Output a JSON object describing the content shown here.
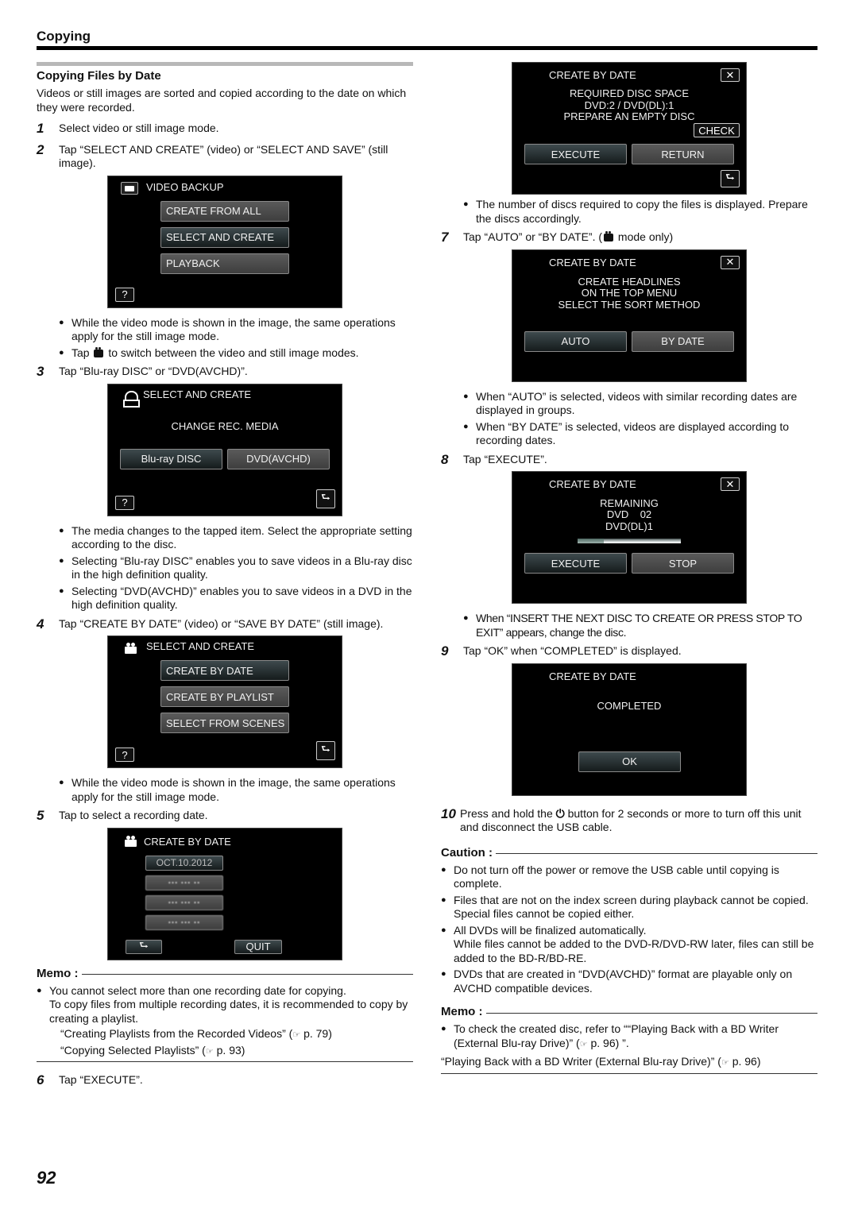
{
  "header": {
    "title": "Copying"
  },
  "section": {
    "title": "Copying Files by Date",
    "intro": "Videos or still images are sorted and copied according to the date on which they were recorded."
  },
  "steps": {
    "s1": {
      "num": "1",
      "text": "Select video or still image mode."
    },
    "s2": {
      "num": "2",
      "text": "Tap “SELECT AND CREATE” (video) or “SELECT AND SAVE” (still image)."
    },
    "s2_bullets": [
      "While the video mode is shown in the image, the same operations apply for the still image mode.",
      "to switch between the video and still image modes."
    ],
    "s2_bullet2_prefix": "Tap",
    "s3": {
      "num": "3",
      "text": "Tap “Blu-ray DISC” or “DVD(AVCHD)”."
    },
    "s3_bullets": [
      "The media changes to the tapped item. Select the appropriate setting according to the disc.",
      "Selecting “Blu-ray DISC” enables you to save videos in a Blu-ray disc in the high definition quality.",
      "Selecting “DVD(AVCHD)” enables you to save videos in a DVD in the high definition quality."
    ],
    "s4": {
      "num": "4",
      "text": "Tap “CREATE BY DATE” (video) or “SAVE BY DATE” (still image)."
    },
    "s4_bullets": [
      "While the video mode is shown in the image, the same operations apply for the still image mode."
    ],
    "s5": {
      "num": "5",
      "text": "Tap to select a recording date."
    },
    "s6": {
      "num": "6",
      "text": "Tap “EXECUTE”."
    },
    "s6_bullets": [
      "The number of discs required to copy the files is displayed. Prepare the discs accordingly."
    ],
    "s7": {
      "num": "7",
      "text_a": "Tap “AUTO” or “BY DATE”. (",
      "text_b": "mode only)"
    },
    "s7_bullets": [
      "When “AUTO” is selected, videos with similar recording dates are displayed in groups.",
      "When “BY DATE” is selected, videos are displayed according to recording dates."
    ],
    "s8": {
      "num": "8",
      "text": "Tap “EXECUTE”."
    },
    "s8_bullets": [
      "When “INSERT THE NEXT DISC TO CREATE OR PRESS STOP TO EXIT” appears, change the disc."
    ],
    "s9": {
      "num": "9",
      "text": "Tap “OK” when “COMPLETED” is displayed."
    },
    "s10": {
      "num": "10",
      "text_a": "Press and hold the",
      "text_b": "button for 2 seconds or more to turn off this unit and disconnect the USB cable."
    }
  },
  "screens": {
    "video_backup": {
      "title": "VIDEO BACKUP",
      "buttons": [
        "CREATE FROM ALL",
        "SELECT AND CREATE",
        "PLAYBACK"
      ],
      "help": "?"
    },
    "change_media": {
      "title": "SELECT AND CREATE",
      "message": "CHANGE REC. MEDIA",
      "buttons": [
        "Blu-ray DISC",
        "DVD(AVCHD)"
      ],
      "help": "?"
    },
    "select_create": {
      "title": "SELECT AND CREATE",
      "buttons": [
        "CREATE BY DATE",
        "CREATE BY PLAYLIST",
        "SELECT FROM SCENES"
      ],
      "help": "?"
    },
    "create_by_date_list": {
      "title": "CREATE BY DATE",
      "dates": [
        "OCT.10.2012",
        "▪▪▪ ▪▪▪ ▪▪",
        "▪▪▪ ▪▪▪ ▪▪",
        "▪▪▪ ▪▪▪ ▪▪"
      ],
      "quit": "QUIT"
    },
    "required_space": {
      "title": "CREATE BY DATE",
      "lines": [
        "REQUIRED DISC SPACE",
        "DVD:2 / DVD(DL):1",
        "PREPARE AN EMPTY DISC"
      ],
      "check": "CHECK",
      "buttons": [
        "EXECUTE",
        "RETURN"
      ]
    },
    "sort_method": {
      "title": "CREATE BY DATE",
      "lines": [
        "CREATE HEADLINES",
        "ON THE TOP MENU",
        "SELECT THE SORT METHOD"
      ],
      "buttons": [
        "AUTO",
        "BY DATE"
      ]
    },
    "remaining": {
      "title": "CREATE BY DATE",
      "lines": [
        "REMAINING",
        "DVD    02",
        "DVD(DL)1"
      ],
      "progress_percent": 25,
      "buttons": [
        "EXECUTE",
        "STOP"
      ]
    },
    "completed": {
      "title": "CREATE BY DATE",
      "message": "COMPLETED",
      "ok": "OK"
    }
  },
  "memo_left": {
    "heading": "Memo :",
    "bullet_lines": [
      "You cannot select more than one recording date for copying.",
      "To copy files from multiple recording dates, it is recommended to copy by creating a playlist."
    ],
    "refs": [
      {
        "text": "“Creating Playlists from the Recorded Videos” (",
        "page": "p. 79)"
      },
      {
        "text": "“Copying Selected Playlists” (",
        "page": "p. 93)"
      }
    ]
  },
  "caution": {
    "heading": "Caution :",
    "bullets": [
      "Do not turn off the power or remove the USB cable until copying is complete.",
      "Files that are not on the index screen during playback cannot be copied. Special files cannot be copied either.",
      "All DVDs will be finalized automatically.",
      "DVDs that are created in “DVD(AVCHD)” format are playable only on AVCHD compatible devices."
    ],
    "bullet3_extra": "While files cannot be added to the DVD-R/DVD-RW later, files can still be added to the BD-R/BD-RE."
  },
  "memo_right": {
    "heading": "Memo :",
    "bullet": "To check the created disc, refer to ““Playing Back with a BD Writer (External Blu-ray Drive)” (",
    "bullet_page": "p. 96) ”.",
    "ref": {
      "text": "“Playing Back with a BD Writer (External Blu-ray Drive)” (",
      "page": "p. 96)"
    }
  },
  "icons": {
    "ref_pointer": "☞",
    "power": "⏻",
    "help": "?",
    "back": "⮑",
    "close": "✕"
  },
  "page_number": "92"
}
